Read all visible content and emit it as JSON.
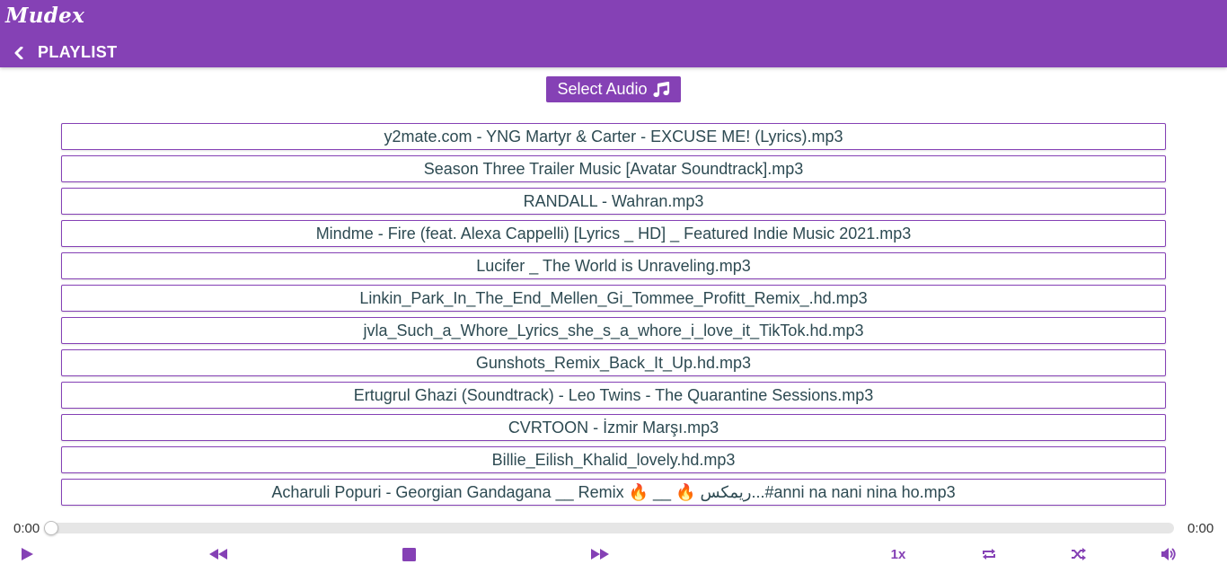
{
  "app": {
    "logo": "Mudex",
    "page_title": "PLAYLIST"
  },
  "select_audio": {
    "label": "Select Audio",
    "icon": "music-note-icon"
  },
  "playlist": [
    "y2mate.com - YNG Martyr & Carter - EXCUSE ME! (Lyrics).mp3",
    "Season Three Trailer Music [Avatar Soundtrack].mp3",
    "RANDALL - Wahran.mp3",
    "Mindme - Fire (feat. Alexa Cappelli) [Lyrics _ HD] _ Featured Indie Music 2021.mp3",
    "Lucifer _ The World is Unraveling.mp3",
    "Linkin_Park_In_The_End_Mellen_Gi_Tommee_Profitt_Remix_.hd.mp3",
    "jvla_Such_a_Whore_Lyrics_she_s_a_whore_i_love_it_TikTok.hd.mp3",
    "Gunshots_Remix_Back_It_Up.hd.mp3",
    "Ertugrul Ghazi (Soundtrack) - Leo Twins - The Quarantine Sessions.mp3",
    "CVRTOON - İzmir Marşı.mp3",
    "Billie_Eilish_Khalid_lovely.hd.mp3",
    "Acharuli Popuri - Georgian Gandagana __ Remix 🔥 __ 🔥 ريمكس...#anni na nani nina ho.mp3"
  ],
  "player": {
    "current_time": "0:00",
    "duration": "0:00",
    "progress": 0,
    "speed": "1x"
  },
  "colors": {
    "accent": "#8541b5",
    "track_text": "#2d4a52"
  },
  "icons": {
    "back": "chevron-left-icon",
    "play": "play-icon",
    "rewind": "rewind-icon",
    "stop": "stop-icon",
    "forward": "fast-forward-icon",
    "repeat": "repeat-icon",
    "shuffle": "shuffle-icon",
    "volume": "volume-icon"
  }
}
